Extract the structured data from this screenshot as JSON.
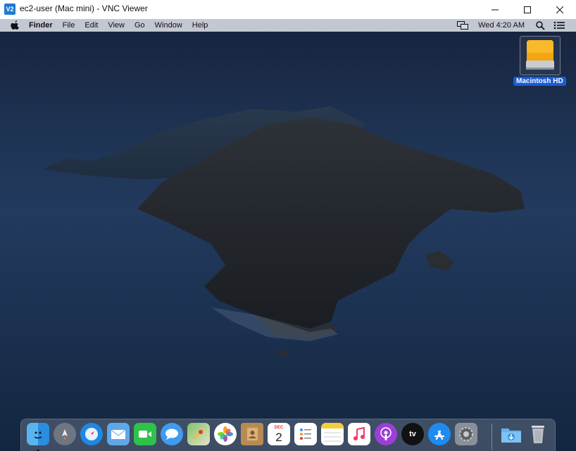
{
  "window": {
    "title": "ec2-user (Mac mini) - VNC Viewer",
    "app_icon_text": "V2"
  },
  "menubar": {
    "items": [
      "Finder",
      "File",
      "Edit",
      "View",
      "Go",
      "Window",
      "Help"
    ],
    "clock": "Wed 4:20 AM"
  },
  "desktop": {
    "drive_label": "Macintosh HD"
  },
  "dock": {
    "calendar_month": "DEC",
    "calendar_day": "2",
    "tv_label": "tv",
    "icons": [
      "finder-icon",
      "launchpad-icon",
      "safari-icon",
      "mail-icon",
      "facetime-icon",
      "messages-icon",
      "maps-icon",
      "photos-icon",
      "contacts-icon",
      "calendar-icon",
      "reminders-icon",
      "notes-icon",
      "music-icon",
      "podcasts-icon",
      "apple-tv-icon",
      "app-store-icon",
      "system-preferences-icon",
      "downloads-icon",
      "trash-icon"
    ]
  },
  "colors": {
    "selection_blue": "#1a5bd6",
    "menubar": "#d2d6de",
    "ocean": "#223a5e"
  }
}
